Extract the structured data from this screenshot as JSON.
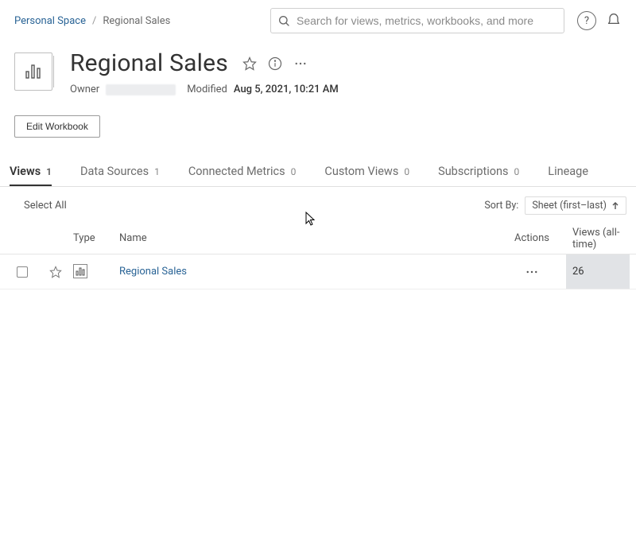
{
  "breadcrumb": {
    "parent": "Personal Space",
    "current": "Regional Sales"
  },
  "search": {
    "placeholder": "Search for views, metrics, workbooks, and more"
  },
  "header": {
    "title": "Regional Sales",
    "owner_label": "Owner",
    "modified_label": "Modified",
    "modified_value": "Aug 5, 2021, 10:21 AM"
  },
  "actions": {
    "edit_workbook": "Edit Workbook"
  },
  "tabs": [
    {
      "label": "Views",
      "count": "1",
      "active": true
    },
    {
      "label": "Data Sources",
      "count": "1",
      "active": false
    },
    {
      "label": "Connected Metrics",
      "count": "0",
      "active": false
    },
    {
      "label": "Custom Views",
      "count": "0",
      "active": false
    },
    {
      "label": "Subscriptions",
      "count": "0",
      "active": false
    },
    {
      "label": "Lineage",
      "count": "",
      "active": false
    }
  ],
  "subbar": {
    "select_all": "Select All",
    "sort_by_label": "Sort By:",
    "sort_value": "Sheet (first–last)"
  },
  "table": {
    "columns": {
      "type": "Type",
      "name": "Name",
      "actions": "Actions",
      "views": "Views (all-time)"
    },
    "rows": [
      {
        "name": "Regional Sales",
        "views": "26"
      }
    ]
  }
}
